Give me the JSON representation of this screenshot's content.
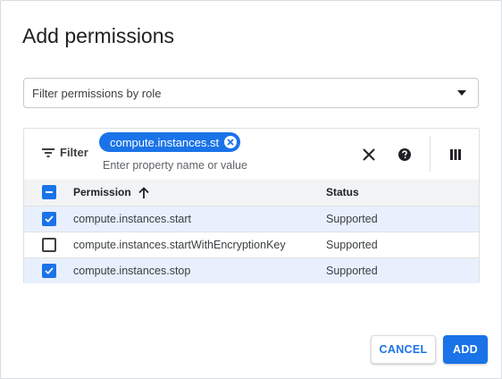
{
  "dialog": {
    "title": "Add permissions"
  },
  "role_select": {
    "placeholder": "Filter permissions by role",
    "icon": "arrow-drop-down-icon"
  },
  "filter": {
    "button_label": "Filter",
    "chip_text": "compute.instances.st",
    "input_placeholder": "Enter property name or value",
    "icons": [
      "filter-icon",
      "close-icon",
      "help-icon",
      "column-display-icon"
    ]
  },
  "table": {
    "columns": [
      "Permission",
      "Status"
    ],
    "sort": {
      "column": "Permission",
      "direction": "ascending"
    },
    "header_checkbox": "indeterminate",
    "rows": [
      {
        "permission": "compute.instances.start",
        "status": "Supported",
        "checked": true
      },
      {
        "permission": "compute.instances.startWithEncryptionKey",
        "status": "Supported",
        "checked": false
      },
      {
        "permission": "compute.instances.stop",
        "status": "Supported",
        "checked": true
      }
    ]
  },
  "actions": {
    "cancel_label": "CANCEL",
    "add_label": "ADD"
  },
  "colors": {
    "accent": "#1a73e8",
    "selected_row": "#e8f0fe",
    "header_bg": "#f1f3f4"
  }
}
